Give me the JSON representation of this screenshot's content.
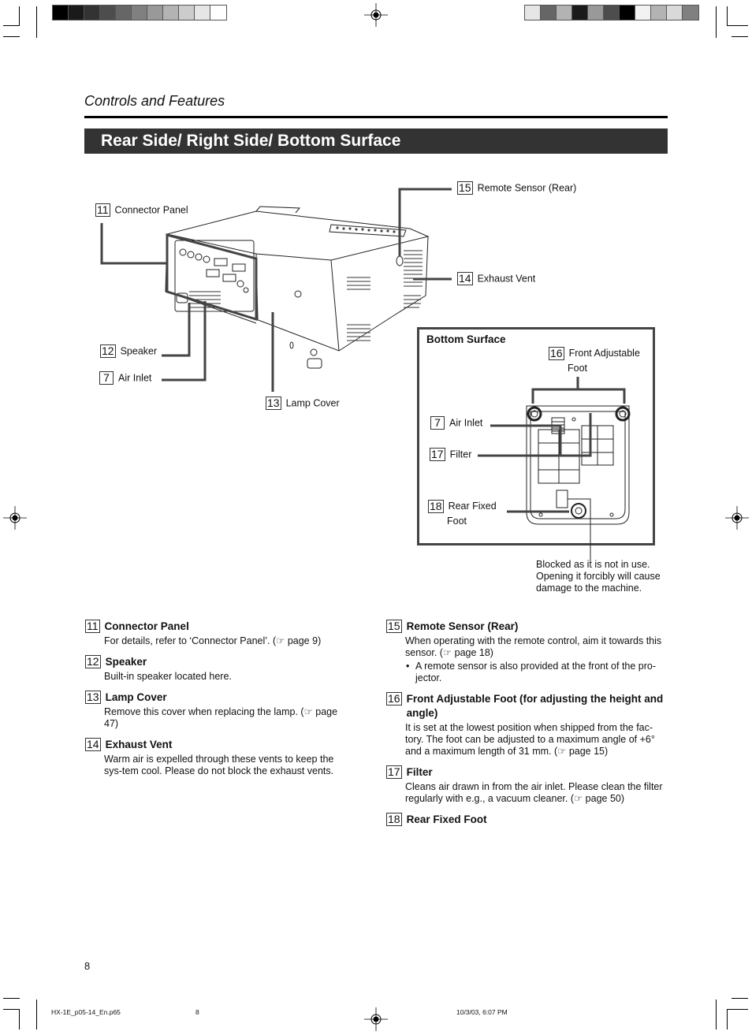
{
  "print_marks": {
    "left_swatches": [
      "#000000",
      "#1a1a1a",
      "#333333",
      "#4d4d4d",
      "#666666",
      "#808080",
      "#999999",
      "#b3b3b3",
      "#cccccc",
      "#e6e6e6",
      "#ffffff"
    ],
    "right_swatches": [
      "#e6e6e6",
      "#666666",
      "#b3b3b3",
      "#1a1a1a",
      "#999999",
      "#4d4d4d",
      "#000000",
      "#f2f2f2",
      "#b3b3b3",
      "#d9d9d9",
      "#808080"
    ]
  },
  "header": {
    "section": "Controls and Features",
    "banner": "Rear Side/ Right Side/ Bottom Surface",
    "banner_color": "#333333"
  },
  "diagram": {
    "callouts": {
      "connector_panel": {
        "num": "11",
        "label": "Connector Panel"
      },
      "speaker": {
        "num": "12",
        "label": "Speaker"
      },
      "air_inlet": {
        "num": "7",
        "label": "Air Inlet"
      },
      "lamp_cover": {
        "num": "13",
        "label": "Lamp Cover"
      },
      "remote_sensor": {
        "num": "15",
        "label": "Remote Sensor (Rear)"
      },
      "exhaust_vent": {
        "num": "14",
        "label": "Exhaust Vent"
      }
    },
    "bottom_surface": {
      "title": "Bottom Surface",
      "front_foot": {
        "num": "16",
        "label_line1": "Front Adjustable",
        "label_line2": "Foot"
      },
      "air_inlet": {
        "num": "7",
        "label": "Air Inlet"
      },
      "filter": {
        "num": "17",
        "label": "Filter"
      },
      "rear_foot": {
        "num": "18",
        "label_line1": "Rear Fixed",
        "label_line2": "Foot"
      }
    },
    "note": "Blocked as it is not in use. Opening it forcibly will cause damage to the machine."
  },
  "descriptions": {
    "left": [
      {
        "num": "11",
        "title": "Connector Panel",
        "body": "For details, refer to ‘Connector Panel’. (☞ page 9)"
      },
      {
        "num": "12",
        "title": "Speaker",
        "body": "Built-in speaker located here."
      },
      {
        "num": "13",
        "title": "Lamp Cover",
        "body": "Remove this cover when replacing the lamp. (☞ page 47)"
      },
      {
        "num": "14",
        "title": "Exhaust Vent",
        "body": "Warm air is expelled through these vents to keep the sys-tem cool. Please do not block the exhaust vents."
      }
    ],
    "right": [
      {
        "num": "15",
        "title": "Remote Sensor (Rear)",
        "body": "When operating with the remote control, aim it towards this sensor. (☞ page 18)",
        "bullet": "A remote sensor is also provided at the front of the pro-jector."
      },
      {
        "num": "16",
        "title": "Front Adjustable Foot (for adjusting the height and angle)",
        "body": "It is set at the lowest position when shipped from the fac-tory. The foot can be adjusted to a maximum angle of +6° and a maximum length of 31 mm. (☞ page 15)"
      },
      {
        "num": "17",
        "title": "Filter",
        "body": "Cleans air drawn in from the air inlet. Please clean the filter regularly with e.g., a vacuum cleaner. (☞ page 50)"
      },
      {
        "num": "18",
        "title": "Rear Fixed Foot",
        "body": ""
      }
    ]
  },
  "footer": {
    "page_number": "8",
    "file_name": "HX-1E_p05-14_En.p65",
    "file_page": "8",
    "timestamp": "10/3/03, 6:07 PM"
  }
}
